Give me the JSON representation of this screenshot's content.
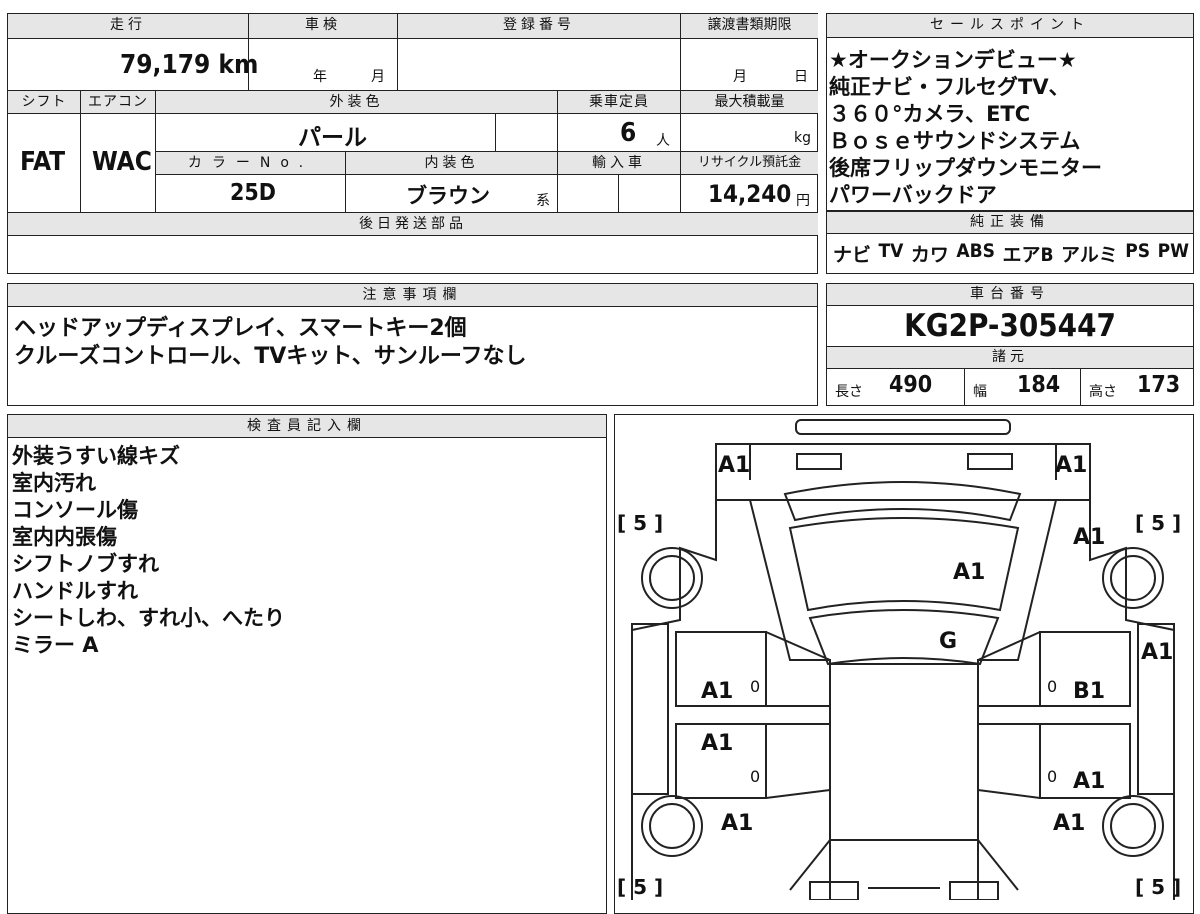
{
  "top_block": {
    "headers": {
      "mileage": "走行",
      "shaken": "車検",
      "registration_no": "登録番号",
      "transfer_deadline": "譲渡書類期限"
    },
    "mileage": "79,179 km",
    "shaken_year_unit": "年",
    "shaken_month_unit": "月",
    "transfer_month_unit": "月",
    "transfer_day_unit": "日",
    "row2_headers": {
      "shift": "シフト",
      "aircon": "エアコン",
      "exterior_color": "外装色",
      "capacity": "乗車定員",
      "max_load": "最大積載量"
    },
    "shift": "FAT",
    "aircon": "WAC",
    "exterior_color": "パール",
    "capacity": "6",
    "capacity_unit": "人",
    "max_load_unit": "kg",
    "row3_headers": {
      "color_no": "カラーNo.",
      "interior_color": "内装色",
      "import": "輸入車",
      "recycle_fee": "リサイクル預託金"
    },
    "color_no": "25D",
    "interior_color": "ブラウン",
    "interior_suffix": "系",
    "recycle_fee": "14,240",
    "recycle_fee_unit": "円",
    "later_parts_header": "後日発送部品"
  },
  "sales_points": {
    "header": "セールスポイント",
    "lines": [
      "★オークションデビュー★",
      "純正ナビ・フルセグTV、",
      "３６０°カメラ、ETC",
      "Ｂｏｓｅサウンドシステム",
      "後席フリップダウンモニター",
      "パワーバックドア"
    ]
  },
  "oem_equipment": {
    "header": "純正装備",
    "items": [
      "ナビ",
      "TV",
      "カワ",
      "ABS",
      "エアB",
      "アルミ",
      "PS",
      "PW"
    ]
  },
  "notes": {
    "header": "注意事項欄",
    "lines": [
      "ヘッドアップディスプレイ、スマートキー2個",
      "クルーズコントロール、TVキット、サンルーフなし"
    ]
  },
  "chassis": {
    "header": "車台番号",
    "number": "KG2P-305447"
  },
  "specs": {
    "header": "諸元",
    "length_label": "長さ",
    "length": "490",
    "width_label": "幅",
    "width": "184",
    "height_label": "高さ",
    "height": "173"
  },
  "inspector": {
    "header": "検査員記入欄",
    "lines": [
      "外装うすい線キズ",
      "室内汚れ",
      "コンソール傷",
      "室内内張傷",
      "シフトノブすれ",
      "ハンドルすれ",
      "シートしわ、すれ小、へたり",
      "ミラー A"
    ]
  },
  "diagram": {
    "marks": {
      "front_left": "A1",
      "front_right": "A1",
      "front_fender_right": "A1",
      "hood": "A1",
      "windshield": "G",
      "fender_right_side": "A1",
      "front_door_left": "A1",
      "front_door_right": "B1",
      "rear_door_left": "A1",
      "rear_door_right": "A1",
      "rear_fender_left": "A1",
      "rear_fender_right": "A1"
    },
    "tires": {
      "front_left": "[ 5 ]",
      "front_right": "[ 5 ]",
      "rear_left": "[ 5 ]",
      "rear_right": "[ 5 ]"
    },
    "zero_marks": [
      "0",
      "0",
      "0",
      "0"
    ]
  }
}
